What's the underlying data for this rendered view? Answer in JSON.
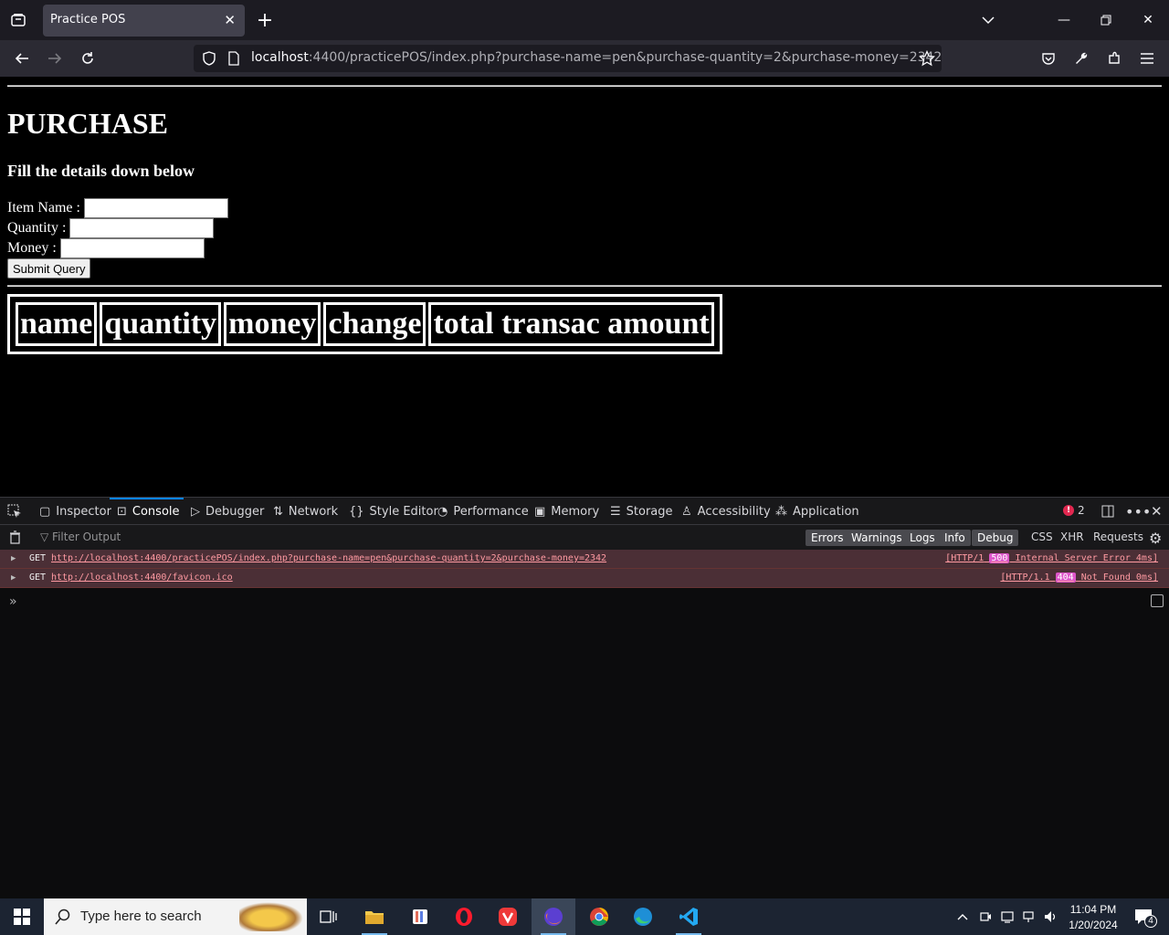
{
  "browser": {
    "tab_title": "Practice POS",
    "url_host": "localhost",
    "url_rest": ":4400/practicePOS/index.php?purchase-name=pen&purchase-quantity=2&purchase-money=2342"
  },
  "page": {
    "title": "PURCHASE",
    "subtitle": "Fill the details down below",
    "form": {
      "item_name_label": "Item Name :",
      "quantity_label": "Quantity :",
      "money_label": "Money :",
      "submit_label": "Submit Query"
    },
    "table_headers": [
      "name",
      "quantity",
      "money",
      "change",
      "total transac amount"
    ]
  },
  "devtools": {
    "tabs": [
      "Inspector",
      "Console",
      "Debugger",
      "Network",
      "Style Editor",
      "Performance",
      "Memory",
      "Storage",
      "Accessibility",
      "Application"
    ],
    "selected_tab": "Console",
    "error_count": "2",
    "filter_placeholder": "Filter Output",
    "filter_buttons": [
      "Errors",
      "Warnings",
      "Logs",
      "Info",
      "Debug"
    ],
    "filter_plain": [
      "CSS",
      "XHR",
      "Requests"
    ],
    "logs": [
      {
        "method": "GET",
        "url": "http://localhost:4400/practicePOS/index.php?purchase-name=pen&purchase-quantity=2&purchase-money=2342",
        "status_prefix": "[HTTP/1",
        "status_code": "500",
        "status_suffix": "Internal Server Error 4ms]"
      },
      {
        "method": "GET",
        "url": "http://localhost:4400/favicon.ico",
        "status_prefix": "[HTTP/1.1",
        "status_code": "404",
        "status_suffix": "Not Found 0ms]"
      }
    ]
  },
  "taskbar": {
    "search_placeholder": "Type here to search",
    "time": "11:04 PM",
    "date": "1/20/2024",
    "notification_count": "4"
  },
  "colors": {
    "accent": "#0a84ff",
    "error_row": "#4b2f36",
    "status_badge": "#dd55c9"
  }
}
